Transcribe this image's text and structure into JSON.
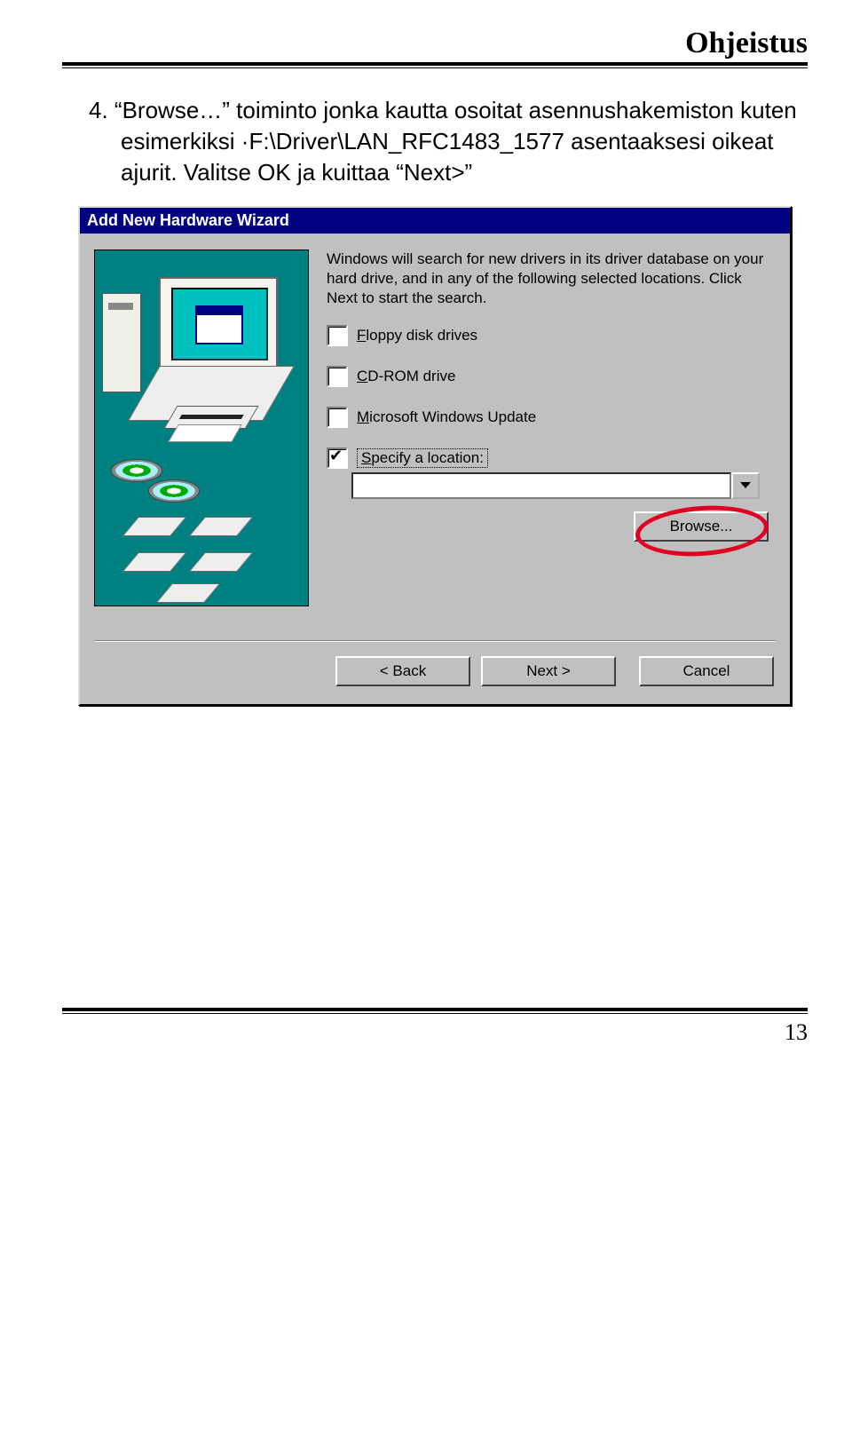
{
  "header": {
    "title": "Ohjeistus"
  },
  "instruction": {
    "number": "4.",
    "text": "“Browse…” toiminto jonka kautta osoitat asennushakemiston kuten esimerkiksi ·F:\\Driver\\LAN_RFC1483_1577 asentaaksesi oikeat ajurit. Valitse OK ja kuittaa “Next>”"
  },
  "wizard": {
    "title": "Add New Hardware Wizard",
    "intro": "Windows will search for new drivers in its driver database on your hard drive, and in any of the following selected locations. Click Next to start the search.",
    "checks": {
      "floppy": {
        "label_pre": "F",
        "label_rest": "loppy disk drives",
        "checked": false
      },
      "cdrom": {
        "label_pre": "C",
        "label_rest": "D-ROM drive",
        "checked": false
      },
      "msupdate": {
        "label_pre": "M",
        "label_rest": "icrosoft Windows Update",
        "checked": false
      },
      "specify": {
        "label_pre": "S",
        "label_rest": "pecify a location:",
        "checked": true
      }
    },
    "combo_value": "",
    "browse_label": "Browse...",
    "buttons": {
      "back": "< Back",
      "next": "Next >",
      "cancel": "Cancel"
    }
  },
  "page_number": "13"
}
